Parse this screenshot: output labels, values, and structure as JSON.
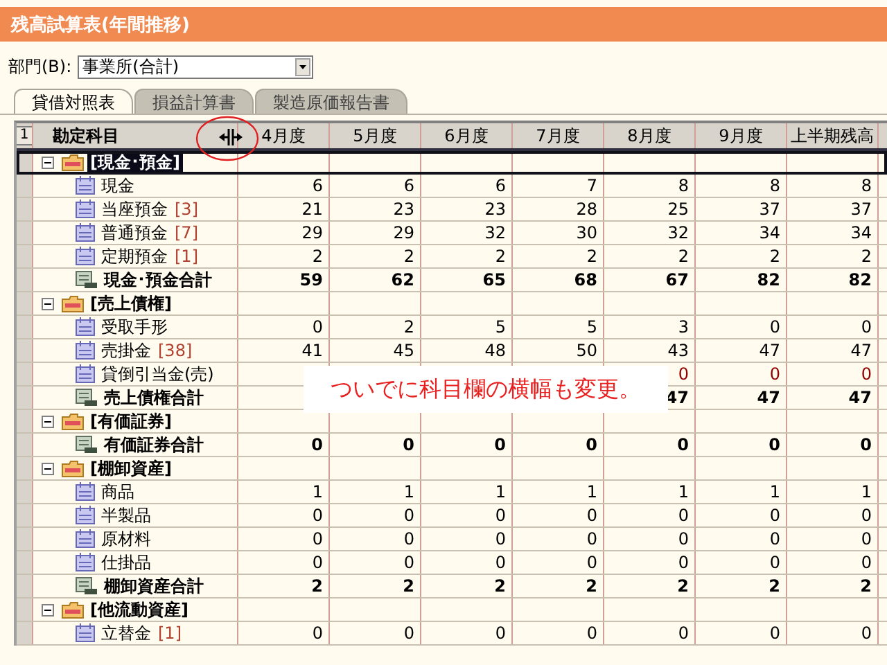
{
  "window": {
    "title": "残高試算表(年間推移)"
  },
  "department": {
    "label": "部門(B):",
    "value": "事業所(合計)"
  },
  "tabs": [
    {
      "label": "貸借対照表",
      "selected": true
    },
    {
      "label": "損益計算書",
      "selected": false
    },
    {
      "label": "製造原価報告書",
      "selected": false
    }
  ],
  "table": {
    "corner": "1",
    "subject_heading": "勘定科目",
    "columns": [
      "4月度",
      "5月度",
      "6月度",
      "7月度",
      "8月度",
      "9月度",
      "上半期残高"
    ],
    "rows": [
      {
        "kind": "group",
        "label": "[現金･預金]",
        "expanded": true,
        "selected": true,
        "children": [
          {
            "kind": "account",
            "label": "現金",
            "selected": false,
            "values": [
              "6",
              "6",
              "6",
              "7",
              "8",
              "8",
              "8"
            ]
          },
          {
            "kind": "account",
            "label": "当座預金",
            "count": "[3]",
            "selected": false,
            "values": [
              "21",
              "23",
              "23",
              "28",
              "25",
              "37",
              "37"
            ]
          },
          {
            "kind": "account",
            "label": "普通預金",
            "count": "[7]",
            "selected": false,
            "values": [
              "29",
              "29",
              "32",
              "30",
              "32",
              "34",
              "34"
            ]
          },
          {
            "kind": "account",
            "label": "定期預金",
            "count": "[1]",
            "selected": false,
            "values": [
              "2",
              "2",
              "2",
              "2",
              "2",
              "2",
              "2"
            ]
          },
          {
            "kind": "total",
            "label": "現金･預金合計",
            "selected": false,
            "values": [
              "59",
              "62",
              "65",
              "68",
              "67",
              "82",
              "82"
            ]
          }
        ]
      },
      {
        "kind": "group",
        "label": "[売上債権]",
        "expanded": true,
        "selected": false,
        "children": [
          {
            "kind": "account",
            "label": "受取手形",
            "selected": false,
            "values": [
              "0",
              "2",
              "5",
              "5",
              "3",
              "0",
              "0"
            ]
          },
          {
            "kind": "account",
            "label": "売掛金",
            "count": "[38]",
            "selected": false,
            "values": [
              "41",
              "45",
              "48",
              "50",
              "43",
              "47",
              "47"
            ]
          },
          {
            "kind": "allowance",
            "label": "貸倒引当金(売)",
            "selected": false,
            "values": [
              "0",
              "0",
              "0"
            ]
          },
          {
            "kind": "total",
            "label": "売上債権合計",
            "selected": false,
            "values": [
              "47",
              "47",
              "47"
            ]
          }
        ]
      },
      {
        "kind": "group",
        "label": "[有価証券]",
        "expanded": true,
        "selected": false,
        "children": [
          {
            "kind": "total",
            "label": "有価証券合計",
            "selected": false,
            "values": [
              "0",
              "0",
              "0",
              "0",
              "0",
              "0",
              "0"
            ]
          }
        ]
      },
      {
        "kind": "group",
        "label": "[棚卸資産]",
        "expanded": true,
        "selected": false,
        "children": [
          {
            "kind": "account",
            "label": "商品",
            "selected": false,
            "values": [
              "1",
              "1",
              "1",
              "1",
              "1",
              "1",
              "1"
            ]
          },
          {
            "kind": "account",
            "label": "半製品",
            "selected": false,
            "values": [
              "0",
              "0",
              "0",
              "0",
              "0",
              "0",
              "0"
            ]
          },
          {
            "kind": "account",
            "label": "原材料",
            "selected": false,
            "values": [
              "0",
              "0",
              "0",
              "0",
              "0",
              "0",
              "0"
            ]
          },
          {
            "kind": "account",
            "label": "仕掛品",
            "selected": false,
            "values": [
              "0",
              "0",
              "0",
              "0",
              "0",
              "0",
              "0"
            ]
          },
          {
            "kind": "total",
            "label": "棚卸資産合計",
            "selected": false,
            "values": [
              "2",
              "2",
              "2",
              "2",
              "2",
              "2",
              "2"
            ]
          }
        ]
      },
      {
        "kind": "group",
        "label": "[他流動資産]",
        "expanded": true,
        "selected": false,
        "children": [
          {
            "kind": "account",
            "label": "立替金",
            "count": "[1]",
            "selected": false,
            "values": [
              "0",
              "0",
              "0",
              "0",
              "0",
              "0",
              "0"
            ]
          }
        ]
      }
    ]
  },
  "annotation": {
    "text": "ついでに科目欄の横幅も変更。"
  }
}
